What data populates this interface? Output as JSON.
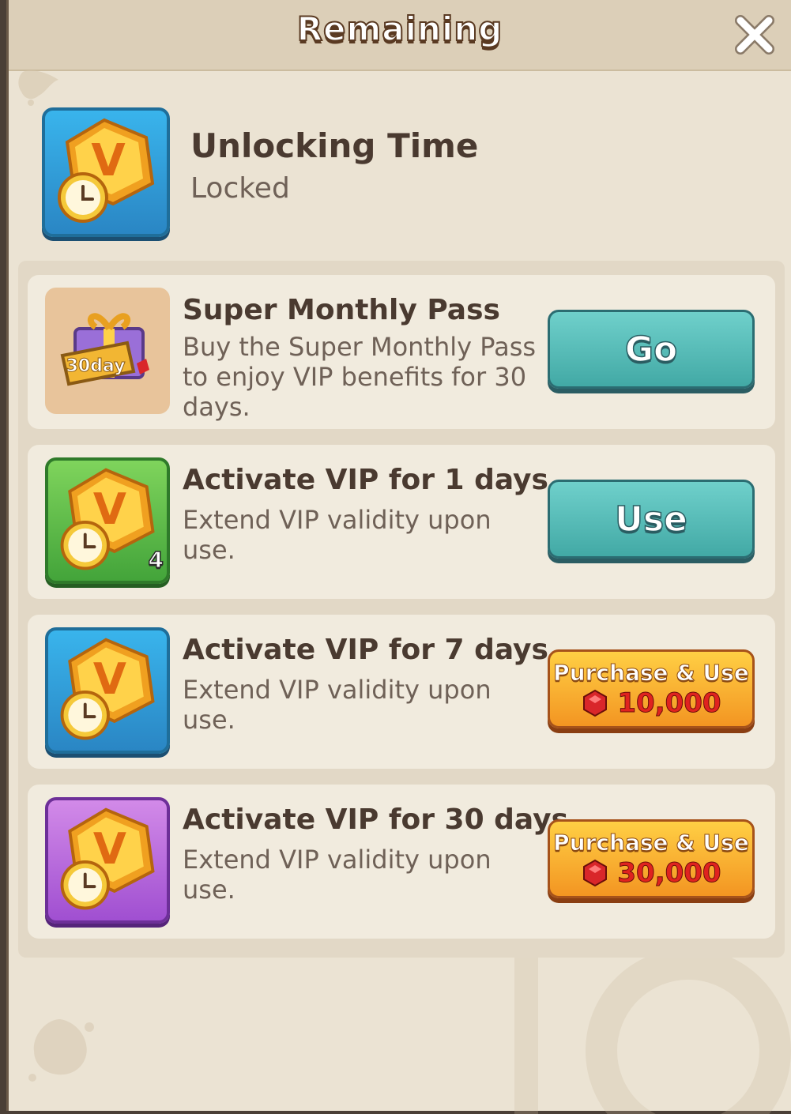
{
  "title": "Remaining",
  "header": {
    "title": "Unlocking Time",
    "status": "Locked",
    "icon": "vip-clock-icon"
  },
  "items": [
    {
      "title": "Super Monthly Pass",
      "description": "Buy the Super Monthly Pass to enjoy VIP benefits for 30 days.",
      "icon": "monthly-pass-gift-icon",
      "icon_text": "30day",
      "button": {
        "label": "Go"
      }
    },
    {
      "title": "Activate VIP for 1 days",
      "description": "Extend VIP validity upon use.",
      "icon": "vip-clock-icon",
      "count": "4",
      "button": {
        "label": "Use"
      }
    },
    {
      "title": "Activate VIP for 7 days",
      "description": "Extend VIP validity upon use.",
      "icon": "vip-clock-icon",
      "button": {
        "label": "Purchase & Use",
        "price": "10,000",
        "currency_icon": "ruby-icon"
      }
    },
    {
      "title": "Activate VIP for 30 days",
      "description": "Extend VIP validity upon use.",
      "icon": "vip-clock-icon",
      "button": {
        "label": "Purchase & Use",
        "price": "30,000",
        "currency_icon": "ruby-icon"
      }
    }
  ],
  "colors": {
    "panel": "#ebe3d3",
    "teal_button": "#4fb7b3",
    "orange_button": "#f7a82a",
    "price": "#e0231f"
  }
}
